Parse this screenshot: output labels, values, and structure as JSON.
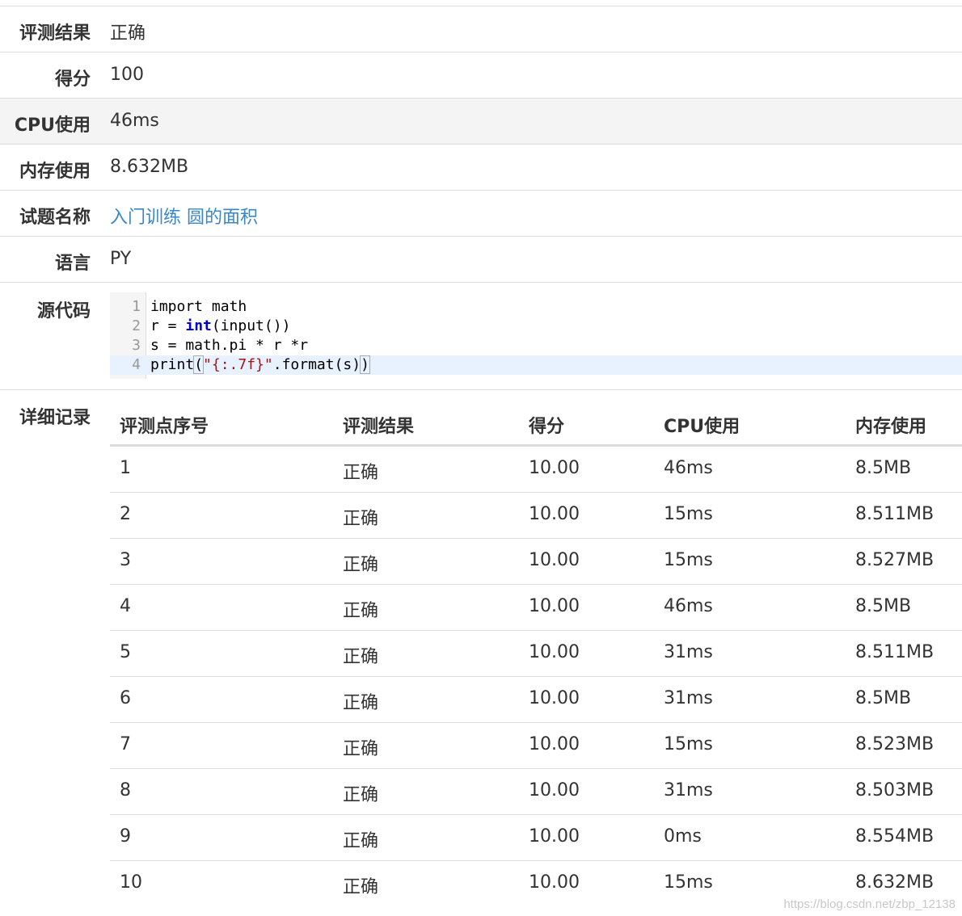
{
  "summary": [
    {
      "label": "评测结果",
      "value": "正确"
    },
    {
      "label": "得分",
      "value": "100"
    },
    {
      "label": "CPU使用",
      "value": "46ms"
    },
    {
      "label": "内存使用",
      "value": "8.632MB"
    },
    {
      "label": "试题名称",
      "value": "入门训练 圆的面积"
    },
    {
      "label": "语言",
      "value": "PY"
    }
  ],
  "source": {
    "label": "源代码",
    "lines": [
      {
        "no": "1",
        "text": "import math"
      },
      {
        "no": "2",
        "pre": "r = ",
        "kw": "int",
        "post": "(input())"
      },
      {
        "no": "3",
        "text": "s = math.pi * r *r"
      },
      {
        "no": "4",
        "pre": "print",
        "b1": "(",
        "str": "\"{:.7f}\"",
        "mid": ".format(s)",
        "b2": ")"
      }
    ],
    "colors": {
      "keyword": "#0000cc",
      "string": "#a31515",
      "active_line": "#e8f2fe"
    }
  },
  "details": {
    "label": "详细记录",
    "headers": [
      "评测点序号",
      "评测结果",
      "得分",
      "CPU使用",
      "内存使用"
    ],
    "rows": [
      [
        "1",
        "正确",
        "10.00",
        "46ms",
        "8.5MB"
      ],
      [
        "2",
        "正确",
        "10.00",
        "15ms",
        "8.511MB"
      ],
      [
        "3",
        "正确",
        "10.00",
        "15ms",
        "8.527MB"
      ],
      [
        "4",
        "正确",
        "10.00",
        "46ms",
        "8.5MB"
      ],
      [
        "5",
        "正确",
        "10.00",
        "31ms",
        "8.511MB"
      ],
      [
        "6",
        "正确",
        "10.00",
        "31ms",
        "8.5MB"
      ],
      [
        "7",
        "正确",
        "10.00",
        "15ms",
        "8.523MB"
      ],
      [
        "8",
        "正确",
        "10.00",
        "31ms",
        "8.503MB"
      ],
      [
        "9",
        "正确",
        "10.00",
        "0ms",
        "8.554MB"
      ],
      [
        "10",
        "正确",
        "10.00",
        "15ms",
        "8.632MB"
      ]
    ]
  },
  "watermark": "https://blog.csdn.net/zbp_12138",
  "colors": {
    "link": "#3a87c9",
    "border": "#dddddd",
    "shade": "#f4f4f4"
  }
}
